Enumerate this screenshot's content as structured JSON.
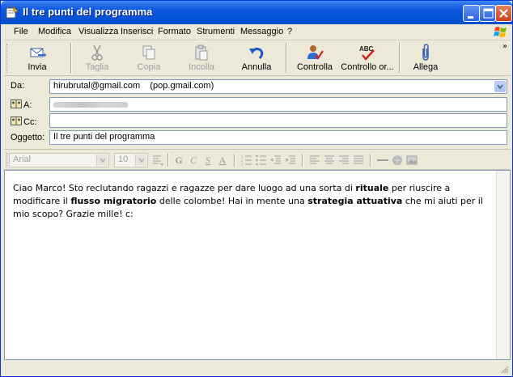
{
  "window": {
    "title": "Il tre punti del programma"
  },
  "menu": [
    "File",
    "Modifica",
    "Visualizza",
    "Inserisci",
    "Formato",
    "Strumenti",
    "Messaggio",
    "?"
  ],
  "toolbar": {
    "send": "Invia",
    "cut": "Taglia",
    "copy": "Copia",
    "paste": "Incolla",
    "undo": "Annulla",
    "check": "Controlla",
    "spell": "Controllo or...",
    "attach": "Allega",
    "more": "»"
  },
  "header": {
    "from_label": "Da:",
    "from_value": "hirubrutal@gmail.com    (pop.gmail.com)",
    "to_label": "A:",
    "cc_label": "Cc:",
    "cc_value": "",
    "subject_label": "Oggetto:",
    "subject_value": "Il tre punti del programma"
  },
  "format": {
    "font": "Arial",
    "size": "10",
    "bold": "G",
    "italic": "C",
    "underline": "S",
    "color": "A"
  },
  "body": {
    "p1": "Ciao Marco! Sto reclutando ragazzi e ragazze per dare luogo ad una sorta di ",
    "b1": "rituale",
    "p2": " per riuscire a modificare il ",
    "b2": "flusso migratorio",
    "p3": " delle colombe! Hai in mente una ",
    "b3": "strategia attuativa",
    "p4": " che mi aiuti per il mio scopo? Grazie mille! c:"
  },
  "colors": {
    "titlebar": "#0a57e0",
    "chrome": "#ece9d8",
    "field_border": "#7f9db9"
  }
}
